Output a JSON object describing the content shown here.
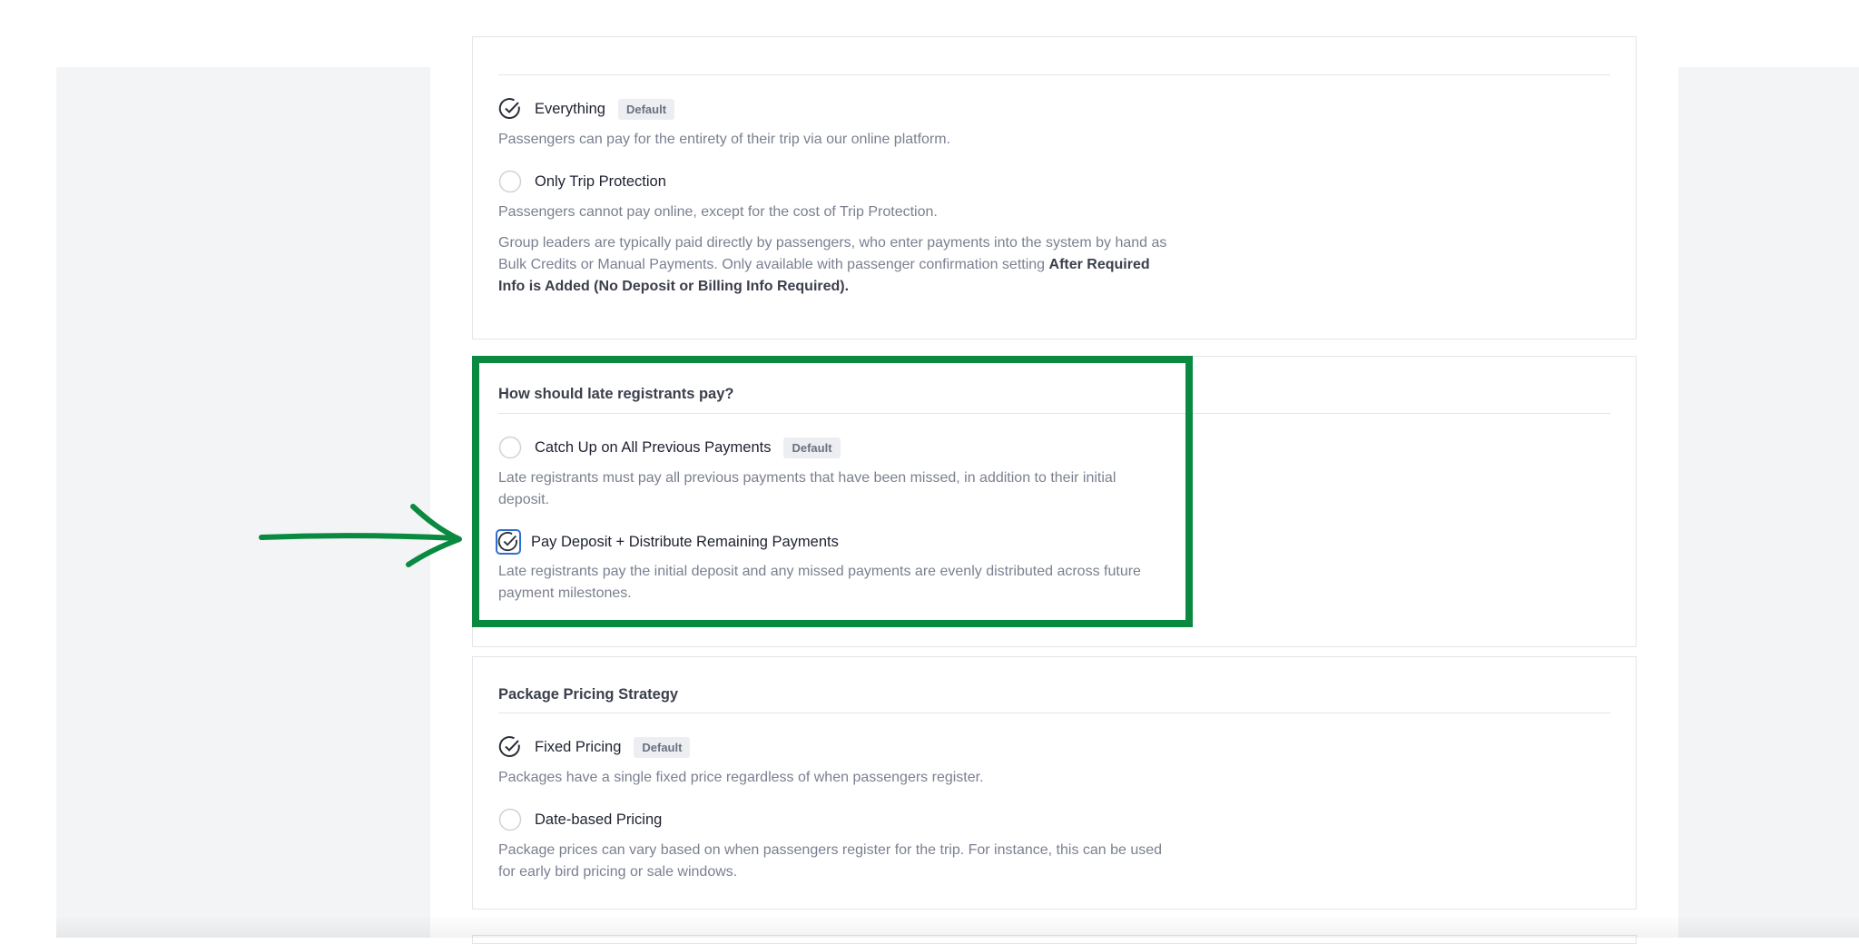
{
  "payment_scope": {
    "options": [
      {
        "label": "Everything",
        "badge": "Default",
        "selected": true,
        "icon": "check-circle-icon",
        "description": "Passengers can pay for the entirety of their trip via our online platform."
      },
      {
        "label": "Only Trip Protection",
        "badge": "",
        "selected": false,
        "icon": "empty-radio-icon",
        "description": "Passengers cannot pay online, except for the cost of Trip Protection.",
        "note": "Group leaders are typically paid directly by passengers, who enter payments into the system by hand as Bulk Credits or Manual Payments. Only available with passenger confirmation setting",
        "note_bold": "After Required Info is Added (No Deposit or Billing Info Required)."
      }
    ]
  },
  "late_registrants": {
    "title": "How should late registrants pay?",
    "options": [
      {
        "label": "Catch Up on All Previous Payments",
        "badge": "Default",
        "selected": false,
        "icon": "empty-radio-icon",
        "description": "Late registrants must pay all previous payments that have been missed, in addition to their initial deposit."
      },
      {
        "label": "Pay Deposit + Distribute Remaining Payments",
        "badge": "",
        "selected": true,
        "focused": true,
        "icon": "check-circle-icon",
        "description": "Late registrants pay the initial deposit and any missed payments are evenly distributed across future payment milestones."
      }
    ]
  },
  "pricing_strategy": {
    "title": "Package Pricing Strategy",
    "options": [
      {
        "label": "Fixed Pricing",
        "badge": "Default",
        "selected": true,
        "icon": "check-circle-icon",
        "description": "Packages have a single fixed price regardless of when passengers register."
      },
      {
        "label": "Date-based Pricing",
        "badge": "",
        "selected": false,
        "icon": "empty-radio-icon",
        "description": "Package prices can vary based on when passengers register for the trip. For instance, this can be used for early bird pricing or sale windows."
      }
    ]
  },
  "annotation": {
    "highlight_color": "#0a8a40",
    "arrow_icon": "hand-drawn-arrow-icon"
  },
  "colors": {
    "backdrop": "#f3f4f6",
    "border": "#e3e5ea",
    "focus_ring": "#2f6fd1",
    "muted_text": "#7b8090"
  }
}
